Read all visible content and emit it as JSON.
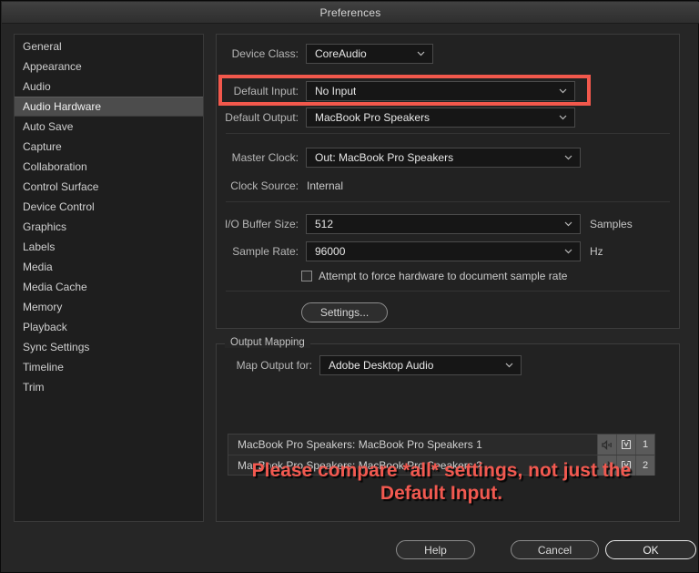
{
  "window": {
    "title": "Preferences"
  },
  "sidebar": {
    "items": [
      {
        "label": "General",
        "selected": false
      },
      {
        "label": "Appearance",
        "selected": false
      },
      {
        "label": "Audio",
        "selected": false
      },
      {
        "label": "Audio Hardware",
        "selected": true
      },
      {
        "label": "Auto Save",
        "selected": false
      },
      {
        "label": "Capture",
        "selected": false
      },
      {
        "label": "Collaboration",
        "selected": false
      },
      {
        "label": "Control Surface",
        "selected": false
      },
      {
        "label": "Device Control",
        "selected": false
      },
      {
        "label": "Graphics",
        "selected": false
      },
      {
        "label": "Labels",
        "selected": false
      },
      {
        "label": "Media",
        "selected": false
      },
      {
        "label": "Media Cache",
        "selected": false
      },
      {
        "label": "Memory",
        "selected": false
      },
      {
        "label": "Playback",
        "selected": false
      },
      {
        "label": "Sync Settings",
        "selected": false
      },
      {
        "label": "Timeline",
        "selected": false
      },
      {
        "label": "Trim",
        "selected": false
      }
    ]
  },
  "device_settings": {
    "device_class": {
      "label": "Device Class:",
      "value": "CoreAudio"
    },
    "default_input": {
      "label": "Default Input:",
      "value": "No Input"
    },
    "default_output": {
      "label": "Default Output:",
      "value": "MacBook Pro Speakers"
    },
    "master_clock": {
      "label": "Master Clock:",
      "value": "Out: MacBook Pro Speakers"
    },
    "clock_source": {
      "label": "Clock Source:",
      "value": "Internal"
    },
    "io_buffer_size": {
      "label": "I/O Buffer Size:",
      "value": "512",
      "unit": "Samples"
    },
    "sample_rate": {
      "label": "Sample Rate:",
      "value": "96000",
      "unit": "Hz"
    },
    "force_sample_rate": {
      "label": "Attempt to force hardware to document sample rate",
      "checked": false
    },
    "settings_button": "Settings..."
  },
  "output_mapping": {
    "legend": "Output Mapping",
    "map_output_for": {
      "label": "Map Output for:",
      "value": "Adobe Desktop Audio"
    },
    "rows": [
      {
        "label": "MacBook Pro Speakers: MacBook Pro Speakers 1",
        "pan_icon": "speaker-right-icon",
        "clip_icon": "clip-icon",
        "channel": "1"
      },
      {
        "label": "MacBook Pro Speakers: MacBook Pro Speakers 2",
        "pan_icon": "speaker-left-icon",
        "clip_icon": "clip-icon",
        "channel": "2"
      }
    ]
  },
  "annotation": {
    "text": "Please compare *all* settings, not just the Default Input.",
    "color": "#f25950"
  },
  "highlight": {
    "target": "Default Input:",
    "color": "#f2584c"
  },
  "buttons": {
    "help": "Help",
    "cancel": "Cancel",
    "ok": "OK"
  }
}
